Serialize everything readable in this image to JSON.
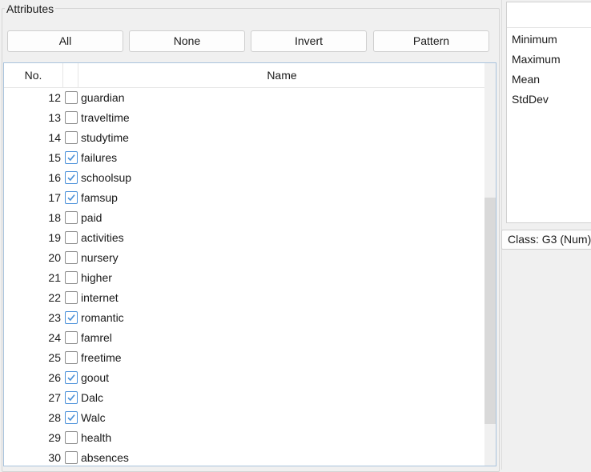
{
  "attributes_panel": {
    "title": "Attributes",
    "buttons": {
      "all": "All",
      "none": "None",
      "invert": "Invert",
      "pattern": "Pattern"
    },
    "table": {
      "columns": {
        "no": "No.",
        "name": "Name"
      },
      "rows": [
        {
          "no": "12",
          "name": "guardian",
          "checked": false
        },
        {
          "no": "13",
          "name": "traveltime",
          "checked": false
        },
        {
          "no": "14",
          "name": "studytime",
          "checked": false
        },
        {
          "no": "15",
          "name": "failures",
          "checked": true
        },
        {
          "no": "16",
          "name": "schoolsup",
          "checked": true
        },
        {
          "no": "17",
          "name": "famsup",
          "checked": true
        },
        {
          "no": "18",
          "name": "paid",
          "checked": false
        },
        {
          "no": "19",
          "name": "activities",
          "checked": false
        },
        {
          "no": "20",
          "name": "nursery",
          "checked": false
        },
        {
          "no": "21",
          "name": "higher",
          "checked": false
        },
        {
          "no": "22",
          "name": "internet",
          "checked": false
        },
        {
          "no": "23",
          "name": "romantic",
          "checked": true
        },
        {
          "no": "24",
          "name": "famrel",
          "checked": false
        },
        {
          "no": "25",
          "name": "freetime",
          "checked": false
        },
        {
          "no": "26",
          "name": "goout",
          "checked": true
        },
        {
          "no": "27",
          "name": "Dalc",
          "checked": true
        },
        {
          "no": "28",
          "name": "Walc",
          "checked": true
        },
        {
          "no": "29",
          "name": "health",
          "checked": false
        },
        {
          "no": "30",
          "name": "absences",
          "checked": false
        }
      ]
    }
  },
  "stats_panel": {
    "labels": [
      "Minimum",
      "Maximum",
      "Mean",
      "StdDev"
    ]
  },
  "class_selector": {
    "selected": "Class: G3 (Num)"
  },
  "colors": {
    "check_accent": "#4a90d9",
    "table_border": "#a9c3dd"
  }
}
